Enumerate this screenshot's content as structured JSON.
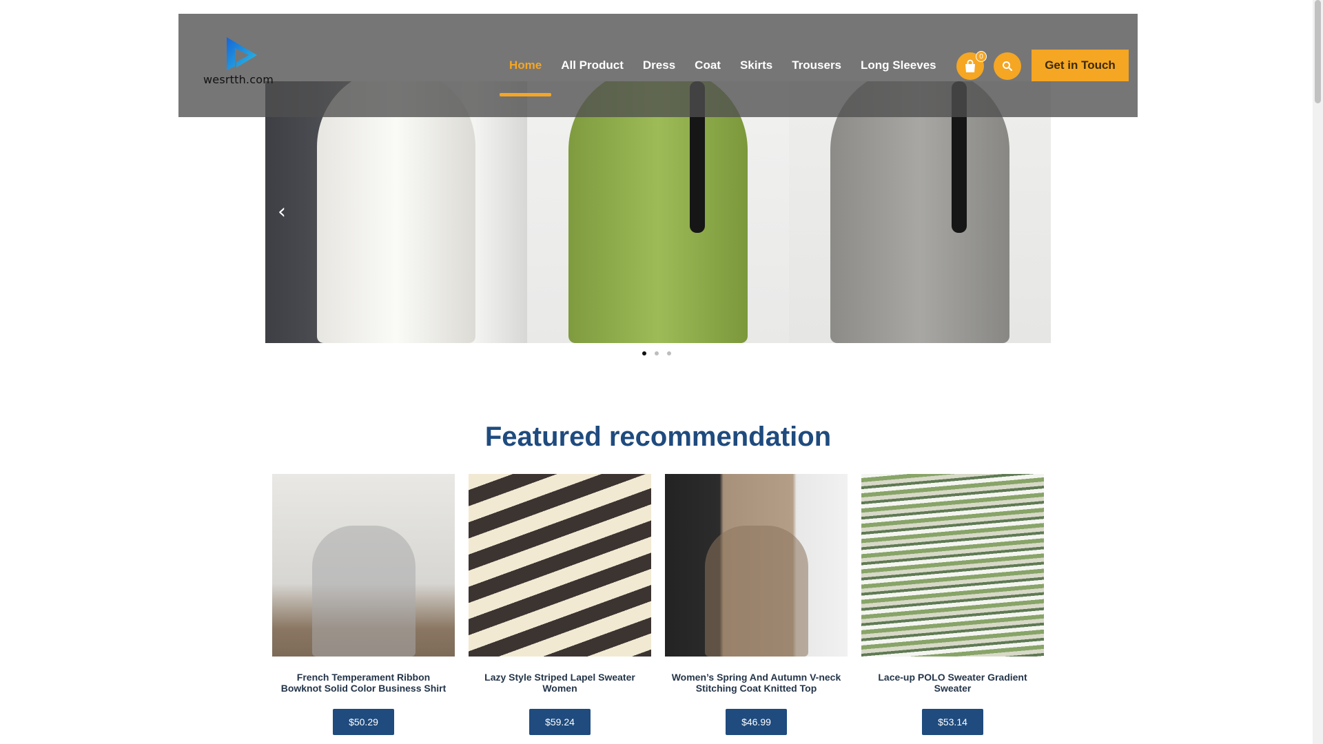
{
  "site": {
    "logo_text": "wesrtth.com"
  },
  "nav": {
    "items": [
      {
        "label": "Home",
        "active": true
      },
      {
        "label": "All Product",
        "active": false
      },
      {
        "label": "Dress",
        "active": false
      },
      {
        "label": "Coat",
        "active": false
      },
      {
        "label": "Skirts",
        "active": false
      },
      {
        "label": "Trousers",
        "active": false
      },
      {
        "label": "Long Sleeves",
        "active": false
      }
    ],
    "cart_count": "0",
    "cta_label": "Get in Touch",
    "accent_color": "#f5a623"
  },
  "hero": {
    "prev_icon": "chevron-left-icon",
    "slides": [
      "white knit dress",
      "green knit dress",
      "grey knit dress"
    ],
    "dots": 3,
    "active_dot": 0
  },
  "featured": {
    "title": "Featured recommendation",
    "title_color": "#1f4b7e",
    "products": [
      {
        "name": "French Temperament Ribbon Bowknot Solid Color Business Shirt",
        "price": "$50.29"
      },
      {
        "name": "Lazy Style Striped Lapel Sweater Women",
        "price": "$59.24"
      },
      {
        "name": "Women’s Spring And Autumn V-neck Stitching Coat Knitted Top",
        "price": "$46.99"
      },
      {
        "name": "Lace-up POLO Sweater Gradient Sweater",
        "price": "$53.14"
      }
    ]
  }
}
